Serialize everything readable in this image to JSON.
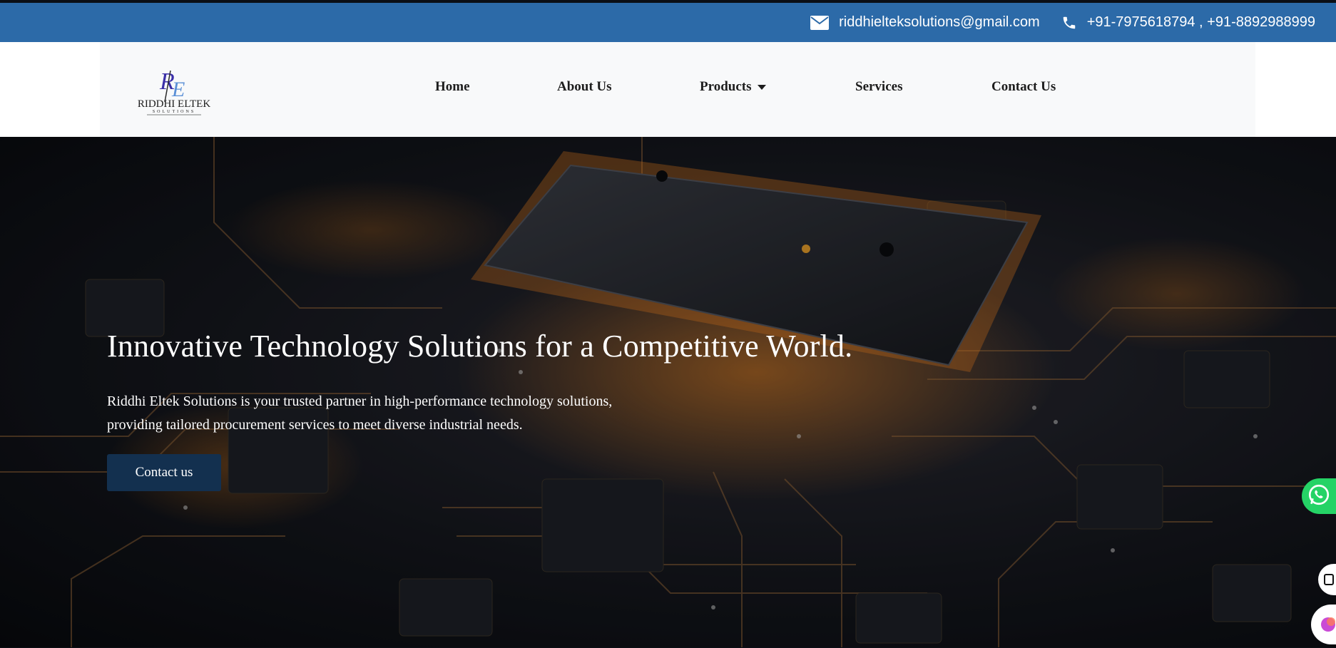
{
  "topbar": {
    "email": "riddhielteksolutions@gmail.com",
    "phones": "+91-7975618794 , +91-8892988999",
    "bg_color": "#2c6aa8",
    "icons": [
      "envelope-icon",
      "phone-icon"
    ]
  },
  "logo": {
    "mark": "RE",
    "name": "RIDDHI ELTEK",
    "sub": "SOLUTIONS"
  },
  "nav": {
    "items": [
      "Home",
      "About Us",
      "Products",
      "Services",
      "Contact Us"
    ]
  },
  "hero": {
    "title": "Innovative Technology Solutions for a Competitive World.",
    "description": "Riddhi Eltek Solutions is your trusted partner in high-performance technology solutions, providing tailored procurement services to meet diverse industrial needs.",
    "cta_label": "Contact us",
    "cta_color": "#13304f"
  },
  "floating": {
    "whatsapp_color": "#25d366",
    "icons": [
      "whatsapp-icon",
      "chat-icon",
      "assistant-icon"
    ]
  }
}
